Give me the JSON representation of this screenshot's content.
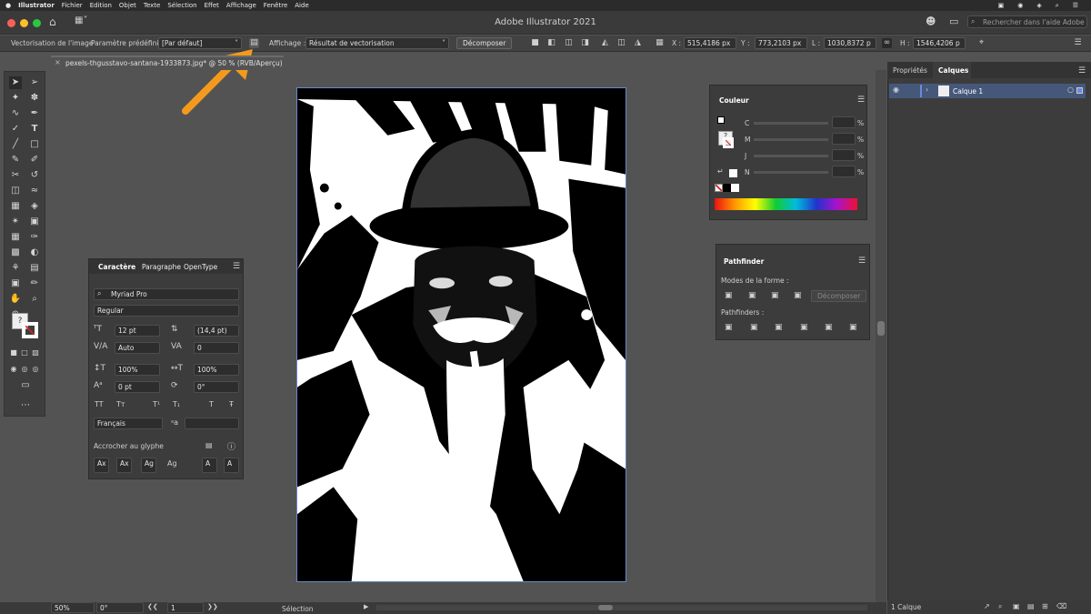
{
  "menubar": {
    "apple": "",
    "app": "Illustrator",
    "items": [
      "Fichier",
      "Edition",
      "Objet",
      "Texte",
      "Sélection",
      "Effet",
      "Affichage",
      "Fenêtre",
      "Aide"
    ],
    "right": [
      "▣",
      "◉",
      "◈",
      "⌕",
      "☰"
    ]
  },
  "window": {
    "title": "Adobe Illustrator 2021",
    "help_placeholder": "Rechercher dans l'aide Adobe"
  },
  "control_bar": {
    "section": "Vectorisation de l'image",
    "preset_label": "Paramètre prédéfini :",
    "preset_value": "[Par défaut]",
    "view_label": "Affichage :",
    "view_value": "Résultat de vectorisation",
    "expand_button": "Décomposer",
    "x_label": "X :",
    "x_value": "515,4186 px",
    "y_label": "Y :",
    "y_value": "773,2103 px",
    "l_label": "L :",
    "l_value": "1030,8372 p",
    "h_label": "H :",
    "h_value": "1546,4206 p"
  },
  "document_tab": {
    "title": "pexels-thgusstavo-santana-1933873.jpg* @ 50 % (RVB/Aperçu)"
  },
  "char_panel": {
    "tabs": [
      "Caractère",
      "Paragraphe",
      "OpenType"
    ],
    "font": "Myriad Pro",
    "style": "Regular",
    "size": "12 pt",
    "leading": "(14,4 pt)",
    "kerning": "Auto",
    "tracking": "0",
    "vscale": "100%",
    "hscale": "100%",
    "baseline": "0 pt",
    "rotation": "0°",
    "lang": "Français",
    "snap_label": "Accrocher au glyphe",
    "glyph_buttons": [
      "TT",
      "Tт",
      "T¹",
      "T₁",
      "T",
      "Ŧ"
    ],
    "snap_buttons": [
      "Ax",
      "Ax",
      "Ag",
      "Ag",
      "A",
      "A"
    ]
  },
  "color_panel": {
    "title": "Couleur",
    "channels": [
      {
        "label": "C",
        "value": "",
        "unit": "%"
      },
      {
        "label": "M",
        "value": "",
        "unit": "%"
      },
      {
        "label": "J",
        "value": "",
        "unit": "%"
      },
      {
        "label": "N",
        "value": "",
        "unit": "%"
      }
    ]
  },
  "pathfinder_panel": {
    "title": "Pathfinder",
    "shape_modes": "Modes de la forme :",
    "expand_button": "Décomposer",
    "pathfinders": "Pathfinders :"
  },
  "right_panel": {
    "tabs": [
      "Propriétés",
      "Calques"
    ],
    "layer_name": "Calque 1",
    "layer_count": "1 Calque"
  },
  "status_bar": {
    "zoom": "50%",
    "rotation": "0°",
    "artboard": "1",
    "mode": "Sélection"
  },
  "colors": {
    "accent_arrow": "#f39a1e",
    "layer_highlight": "#46587a"
  }
}
